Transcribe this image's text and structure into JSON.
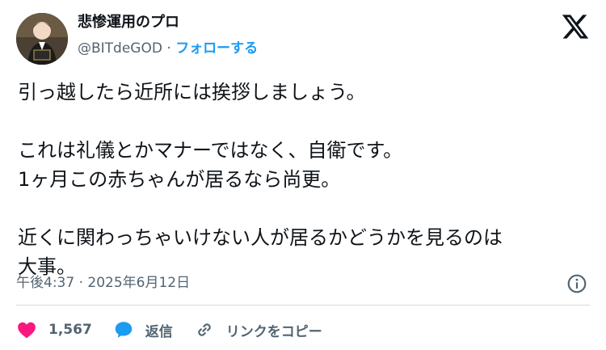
{
  "author": {
    "name": "悲惨運用のプロ",
    "handle": "@BITdeGOD",
    "separator": "·",
    "follow_label": "フォローする"
  },
  "tweet": {
    "text": "引っ越したら近所には挨拶しましょう。\n\nこれは礼儀とかマナーではなく、自衛です。\n1ヶ月この赤ちゃんが居るなら尚更。\n\n近くに関わっちゃいけない人が居るかどうかを見るのは\n大事。"
  },
  "meta": {
    "timestamp": "午後4:37 · 2025年6月12日"
  },
  "actions": {
    "likes_count": "1,567",
    "reply_label": "返信",
    "copy_link_label": "リンクをコピー"
  },
  "icons": {
    "x_logo": "x-logo-icon",
    "info": "info-icon",
    "like": "heart-icon",
    "reply": "reply-bubble-icon",
    "link": "link-icon"
  },
  "colors": {
    "accent": "#1d9bf0",
    "like": "#f91880",
    "text": "#0f1419",
    "muted": "#536471",
    "divider": "#cfd9de"
  }
}
